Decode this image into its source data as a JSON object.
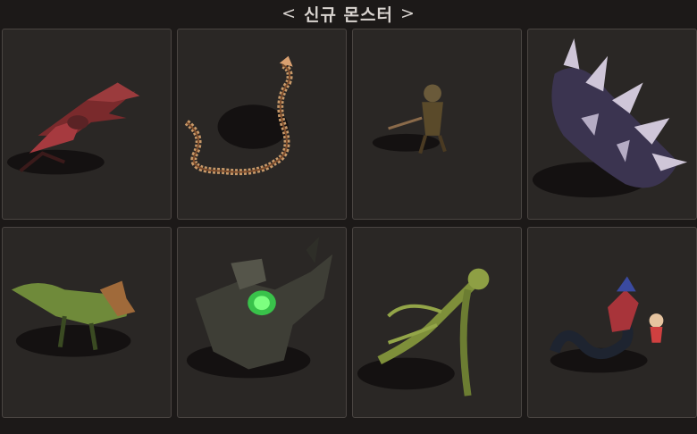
{
  "header": {
    "title": "신규 몬스터",
    "prev_icon": "chevron-left-icon",
    "next_icon": "chevron-right-icon",
    "prev_glyph": "<",
    "next_glyph": ">"
  },
  "monsters": [
    {
      "slot": 1,
      "icon": "red-winged-dragon-monster"
    },
    {
      "slot": 2,
      "icon": "bone-serpent-monster"
    },
    {
      "slot": 3,
      "icon": "small-goblin-monster"
    },
    {
      "slot": 4,
      "icon": "spiked-shadow-beast-monster"
    },
    {
      "slot": 5,
      "icon": "green-lizard-monster"
    },
    {
      "slot": 6,
      "icon": "stone-golem-green-core-monster"
    },
    {
      "slot": 7,
      "icon": "vine-plant-monster"
    },
    {
      "slot": 8,
      "icon": "serpent-with-riders-monster"
    }
  ]
}
